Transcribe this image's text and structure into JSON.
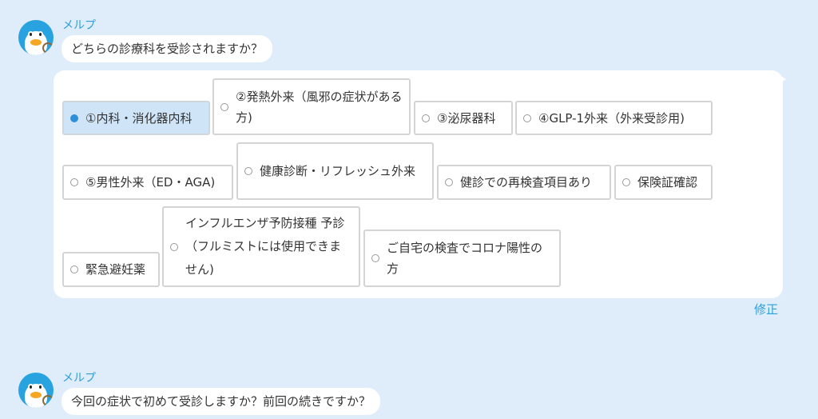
{
  "bot_name": "メルプ",
  "messages": [
    {
      "sender": "メルプ",
      "text": "どちらの診療科を受診されますか？"
    },
    {
      "sender": "メルプ",
      "text": "今回の症状で初めて受診しますか？前回の続きですか？"
    }
  ],
  "options": [
    {
      "label": "①内科・消化器内科",
      "selected": true
    },
    {
      "label": "②発熱外来（風邪の症状がある方)",
      "selected": false
    },
    {
      "label": "③泌尿器科",
      "selected": false
    },
    {
      "label": "④GLP-1外来（外来受診用)",
      "selected": false
    },
    {
      "label": "⑤男性外来（ED・AGA)",
      "selected": false
    },
    {
      "label": "健康診断・リフレッシュ外来",
      "selected": false
    },
    {
      "label": "健診での再検査項目あり",
      "selected": false
    },
    {
      "label": "保険証確認",
      "selected": false
    },
    {
      "label": "緊急避妊薬",
      "selected": false
    },
    {
      "label": "インフルエンザ予防接種 予診（フルミストには使用できません)",
      "selected": false
    },
    {
      "label": "ご自宅の検査でコロナ陽性の方",
      "selected": false
    }
  ],
  "edit_link": "修正",
  "colors": {
    "background": "#deedf9",
    "accent": "#2f9fd8",
    "selected": "#cfe4f6"
  }
}
